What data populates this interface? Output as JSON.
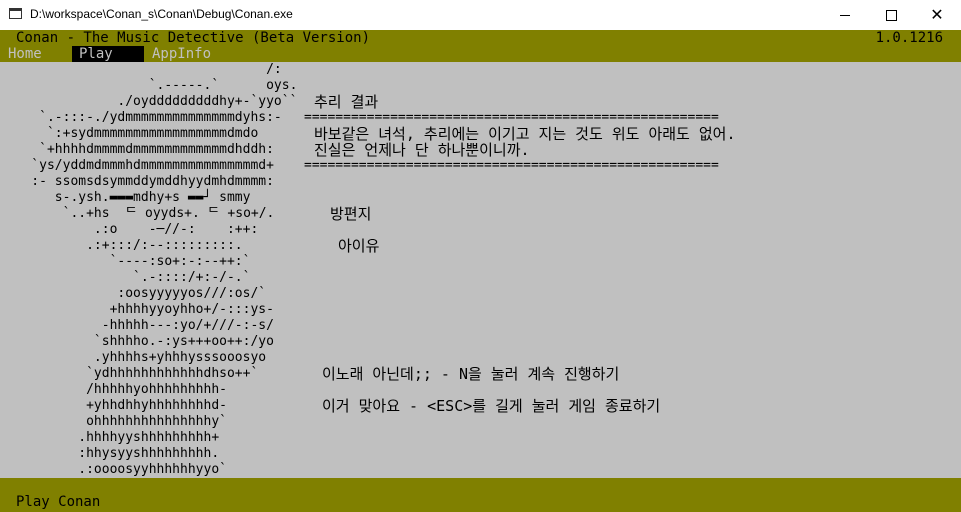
{
  "window": {
    "title": "D:\\workspace\\Conan_s\\Conan\\Debug\\Conan.exe",
    "minimize_glyph": "",
    "maximize_glyph": "",
    "close_glyph": "✕"
  },
  "header": {
    "title": "Conan - The Music Detective (Beta Version)",
    "version": "1.0.1216"
  },
  "nav": {
    "home": "Home",
    "play": "Play",
    "appinfo": "AppInfo"
  },
  "ascii_art": "                                  /:\n                   `.-----.`      oys.\n               ./oydddddddddhy+-`yyo``\n     `.-:::-./ydmmmmmmmmmmmmmmdyhs:-\n      `:+sydmmmmmmmmmmmmmmmmmdmdo\n     `+hhhhdmmmmdmmmmmmmmmmmmdhddh:\n    `ys/yddmdmmmhdmmmmmmmmmmmmmmmd+\n    :- ssomsdsymmddymddhyydmhdmmmm:\n       s-.ysh.▬▬▬mdhy+s ▬▬┘ smmy\n        `..+hs  ᄃ oyyds+. ᄃ +so+/.\n            .:o    -─//-:    :++:\n           .:+:::/:--:::::::::.\n              `----:so+:-:--++:`\n                 `.-::::/+:-/-.`\n               :oosyyyyyos///:os/`\n              +hhhhyyoyhho+/-:::ys-\n             -hhhhh---:yo/+///-:-s/\n            `shhhho.-:ys+++oo++:/yo\n            .yhhhhs+yhhhysssooosyo\n           `ydhhhhhhhhhhhhdhso++`\n           /hhhhhyohhhhhhhhh-\n           +yhhdhhyhhhhhhhhd-\n           ohhhhhhhhhhhhhhhy`\n          .hhhhyyshhhhhhhhh+\n          :hhysyyshhhhhhhhh.\n          .:oooosyyhhhhhhyyo`",
  "result": {
    "heading": "추리 결과",
    "separator": "=====================================================",
    "line1": "바보같은 녀석, 추리에는 이기고 지는 것도 위도 아래도 없어.",
    "line2": "진실은 언제나 단 하나뿐이니까."
  },
  "song": {
    "label": "방편지",
    "artist": "아이유"
  },
  "options": {
    "next": "이노래 아닌데;; - N을 눌러 계속 진행하기",
    "quit": "이거 맞아요 - <ESC>를 길게 눌러 게임 종료하기"
  },
  "footer": {
    "status": "Play Conan"
  }
}
